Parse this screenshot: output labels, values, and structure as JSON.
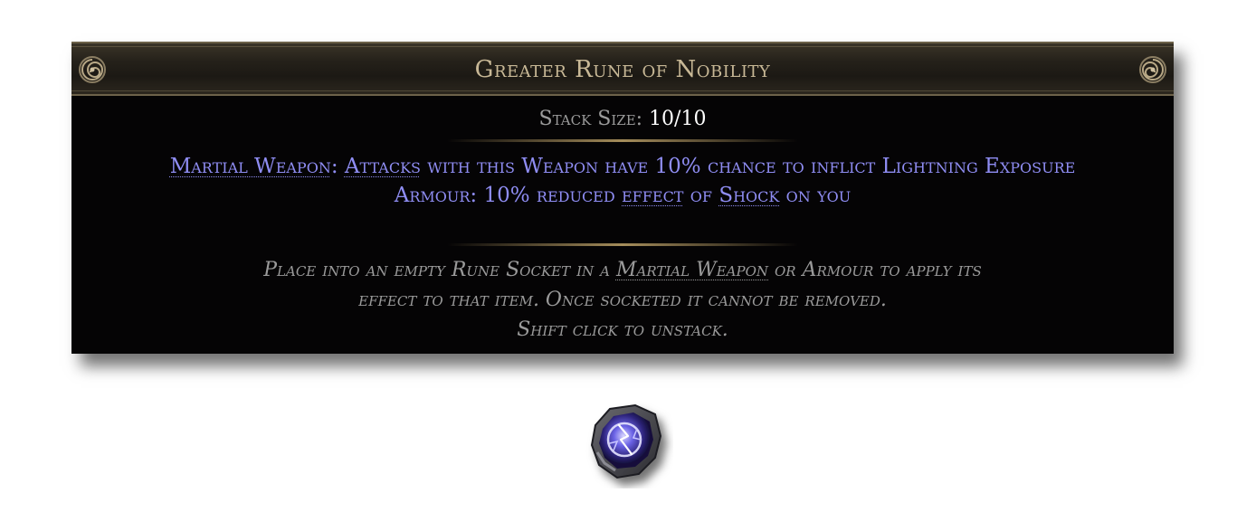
{
  "tooltip": {
    "title": "Greater Rune of Nobility",
    "stack_label": "Stack Size:",
    "stack_value": "10/10",
    "mod1": {
      "part1": "Martial Weapon",
      "part2": ": ",
      "part3": "Attacks",
      "part4": " with this Weapon have 10% chance to inflict Lightning Exposure"
    },
    "mod2": {
      "part1": "Armour: 10% reduced ",
      "part2": "effect",
      "part3": " of ",
      "part4": "Shock",
      "part5": " on you"
    },
    "flavor": {
      "line1_a": "Place into an empty Rune Socket in a ",
      "line1_b": "Martial Weapon",
      "line1_c": " or Armour to apply its",
      "line2": "effect to that item. Once socketed it cannot be removed.",
      "line3": "Shift click to unstack."
    }
  },
  "colors": {
    "title": "#c8b896",
    "magic": "#8f8df3",
    "flavor": "#9a9a9a",
    "stack_label": "#9b9b9b"
  },
  "icons": {
    "header_ornament": "spiral-ornament-icon",
    "item": "lightning-rune-icon"
  }
}
